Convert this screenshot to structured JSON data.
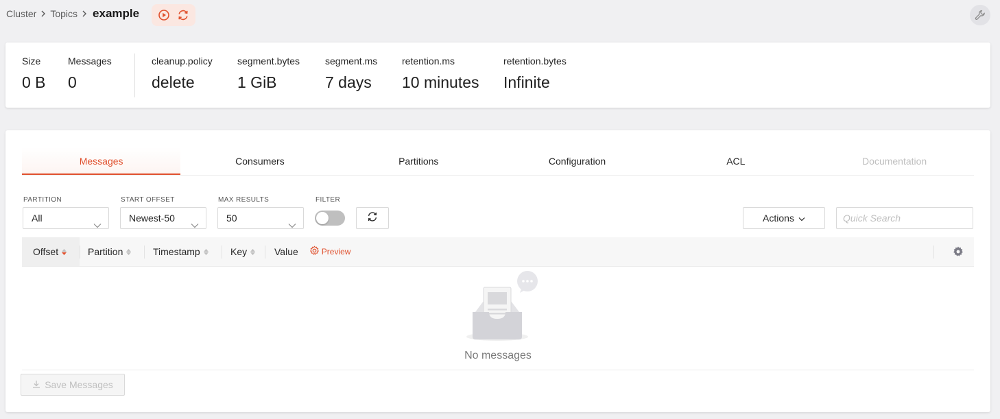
{
  "breadcrumb": {
    "cluster": "Cluster",
    "topics": "Topics",
    "current": "example"
  },
  "stats": [
    {
      "label": "Size",
      "value": "0 B"
    },
    {
      "label": "Messages",
      "value": "0"
    },
    {
      "label": "cleanup.policy",
      "value": "delete"
    },
    {
      "label": "segment.bytes",
      "value": "1 GiB"
    },
    {
      "label": "segment.ms",
      "value": "7 days"
    },
    {
      "label": "retention.ms",
      "value": "10 minutes"
    },
    {
      "label": "retention.bytes",
      "value": "Infinite"
    }
  ],
  "tabs": [
    {
      "label": "Messages",
      "state": "active"
    },
    {
      "label": "Consumers",
      "state": "normal"
    },
    {
      "label": "Partitions",
      "state": "normal"
    },
    {
      "label": "Configuration",
      "state": "normal"
    },
    {
      "label": "ACL",
      "state": "normal"
    },
    {
      "label": "Documentation",
      "state": "disabled"
    }
  ],
  "controls": {
    "partition": {
      "label": "PARTITION",
      "value": "All"
    },
    "start_offset": {
      "label": "START OFFSET",
      "value": "Newest-50"
    },
    "max_results": {
      "label": "MAX RESULTS",
      "value": "50"
    },
    "filter": {
      "label": "FILTER",
      "enabled": false
    },
    "actions_label": "Actions",
    "search_placeholder": "Quick Search"
  },
  "table": {
    "columns": [
      "Offset",
      "Partition",
      "Timestamp",
      "Key",
      "Value"
    ],
    "sorted_column": "Offset",
    "preview_label": "Preview",
    "empty_text": "No messages"
  },
  "save_label": "Save Messages",
  "colors": {
    "accent": "#e0502d",
    "background": "#f0f0f2"
  }
}
